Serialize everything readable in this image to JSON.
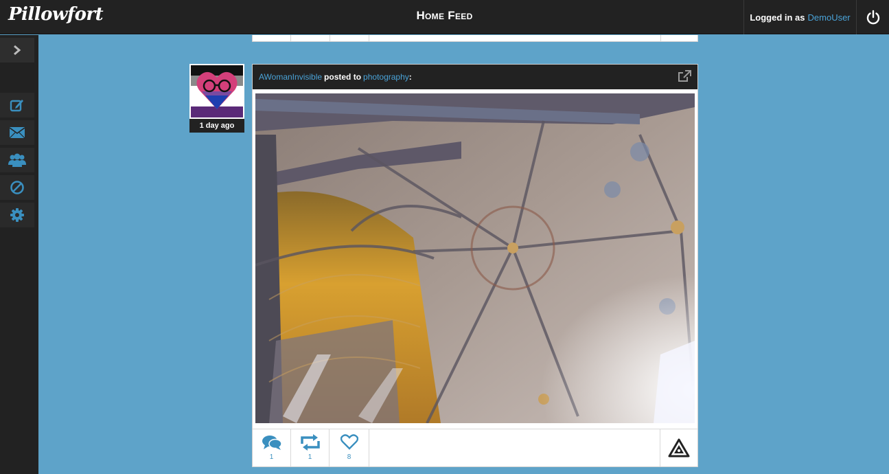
{
  "app": {
    "logo_text": "Pillowfort"
  },
  "header": {
    "title": "Home Feed",
    "logged_in_prefix": "Logged in as",
    "username": "DemoUser"
  },
  "sidebar": {
    "items": [
      {
        "icon": "expand-arrow-icon"
      },
      {
        "icon": "compose-icon"
      },
      {
        "icon": "envelope-icon"
      },
      {
        "icon": "users-icon"
      },
      {
        "icon": "block-icon"
      },
      {
        "icon": "gear-icon"
      }
    ]
  },
  "post": {
    "author": "AWomanInvisible",
    "posted_to_text": "posted to",
    "community": "photography",
    "colon": ":",
    "time_ago": "1 day ago",
    "actions": {
      "comments": {
        "count": "1",
        "icon": "comments-icon"
      },
      "reblogs": {
        "count": "1",
        "icon": "reblog-icon"
      },
      "likes": {
        "count": "8",
        "icon": "heart-icon"
      }
    },
    "image_icon": "cathedral-ceiling-photo",
    "flag_icon": "warning-triangle-icon",
    "external_icon": "external-link-icon"
  },
  "colors": {
    "background": "#5ea3c9",
    "bar": "#222222",
    "link": "#4aa3d8",
    "action": "#3a8fbf"
  }
}
